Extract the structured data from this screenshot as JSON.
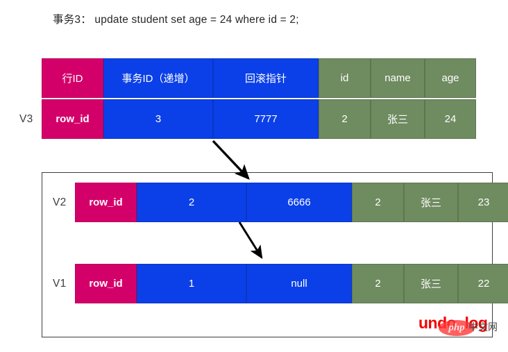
{
  "caption": "事务3： update student set age = 24 where id = 2;",
  "table": {
    "columns": [
      {
        "key": "row_id",
        "header": "行ID",
        "color": "pink"
      },
      {
        "key": "trx_id",
        "header": "事务ID（递增）",
        "color": "blue"
      },
      {
        "key": "roll_ptr",
        "header": "回滚指针",
        "color": "blue"
      },
      {
        "key": "id",
        "header": "id",
        "color": "green"
      },
      {
        "key": "name",
        "header": "name",
        "color": "green"
      },
      {
        "key": "age",
        "header": "age",
        "color": "green"
      }
    ],
    "current_row": {
      "label": "V3",
      "row_id": "row_id",
      "trx_id": "3",
      "roll_ptr": "7777",
      "id": "2",
      "name": "张三",
      "age": "24"
    }
  },
  "undo_log": {
    "watermark_label": "undo_log",
    "badge_label": "php",
    "badge_suffix": "中文网",
    "versions": [
      {
        "label": "V2",
        "row_id": "row_id",
        "trx_id": "2",
        "roll_ptr": "6666",
        "id": "2",
        "name": "张三",
        "age": "23"
      },
      {
        "label": "V1",
        "row_id": "row_id",
        "trx_id": "1",
        "roll_ptr": "null",
        "id": "2",
        "name": "张三",
        "age": "22"
      }
    ]
  },
  "colors": {
    "pink": "#D4006A",
    "blue": "#0B40E8",
    "green": "#6F8B60",
    "arrow": "#000000",
    "watermark_red": "#F20000",
    "box_border": "#3D3D3D"
  }
}
